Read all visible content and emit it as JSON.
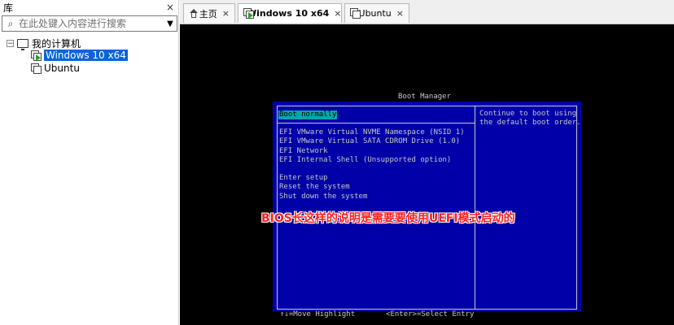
{
  "library": {
    "title": "库",
    "close": "×",
    "search_placeholder": "在此处键入内容进行搜索",
    "tree": {
      "root": "我的计算机",
      "vms": [
        "Windows 10 x64",
        "Ubuntu"
      ]
    }
  },
  "tabs": [
    {
      "label": "主页",
      "close": "×"
    },
    {
      "label": "Windows 10 x64",
      "close": "×"
    },
    {
      "label": "Ubuntu",
      "close": "×"
    }
  ],
  "console": {
    "title": "Boot Manager",
    "entries": [
      "Boot normally",
      "EFI VMware Virtual NVME Namespace (NSID 1)",
      "EFI VMware Virtual SATA CDROM Drive (1.0)",
      "EFI Network",
      "EFI Internal Shell (Unsupported option)",
      "Enter setup",
      "Reset the system",
      "Shut down the system"
    ],
    "help": "Continue to boot using\nthe default boot order.",
    "footer": "↑↓=Move Highlight       <Enter>=Select Entry",
    "annotation": "BIOS长这样的说明是需要要使用UEFI模式启动的"
  },
  "colors": {
    "bios_blue": "#0000a8",
    "highlight": "#00a8a8",
    "selection": "#0a64d8",
    "annotation_red": "#ff2020"
  }
}
